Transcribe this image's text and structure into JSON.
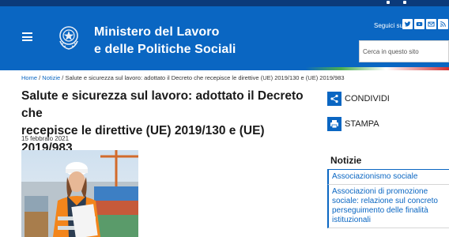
{
  "header": {
    "title_line1": "Ministero del Lavoro",
    "title_line2": "e delle Politiche Sociali",
    "follow_label": "Seguici su:",
    "social": [
      "twitter-icon",
      "youtube-icon",
      "newsletter-icon",
      "rss-icon"
    ],
    "search_placeholder": "Cerca in questo sito"
  },
  "breadcrumb": {
    "home": "Home",
    "separator": " / ",
    "section": "Notizie",
    "current": "Salute e sicurezza sul lavoro: adottato il Decreto che recepisce le direttive (UE) 2019/130 e (UE) 2019/983"
  },
  "article": {
    "title_line1": "Salute e sicurezza sul lavoro: adottato il Decreto che",
    "title_line2": "recepisce le direttive (UE) 2019/130 e (UE) 2019/983",
    "date": "15 febbraio 2021"
  },
  "actions": {
    "share_label": "CONDIVIDI",
    "print_label": "STAMPA"
  },
  "news": {
    "heading": "Notizie",
    "items": [
      "Associazionismo sociale",
      "Associazioni di promozione sociale: relazione sul concreto perseguimento delle finalità istituzionali"
    ]
  },
  "colors": {
    "brand_blue": "#0a66c2",
    "top_strip": "#0b3a7a",
    "tricolore_green": "#4caf50",
    "tricolore_red": "#d32f2f"
  }
}
